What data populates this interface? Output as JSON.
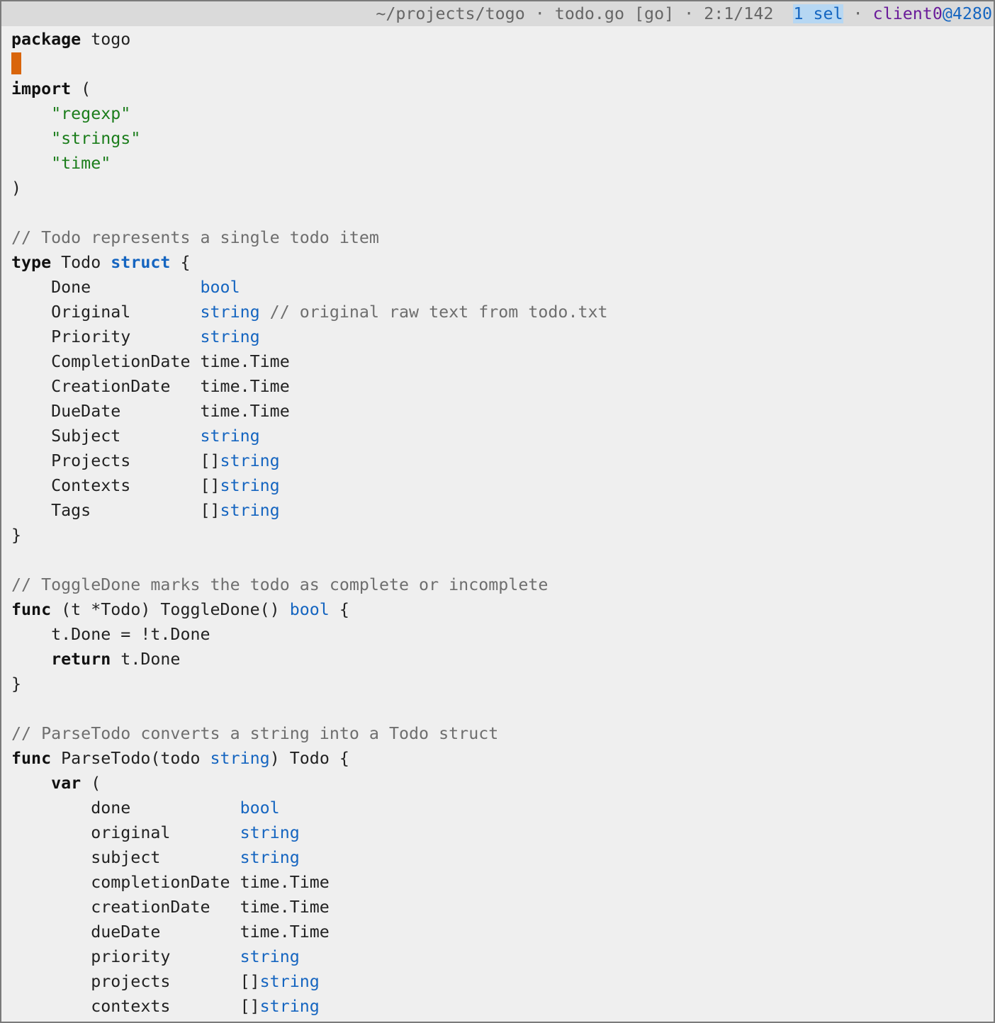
{
  "status": {
    "path": "~/projects/togo",
    "sep": " · ",
    "file": "todo.go",
    "filetype": "[go]",
    "position": "2:1/142",
    "selections": "1 sel",
    "client": "client0",
    "session": "@4280"
  },
  "lines": [
    [
      {
        "t": "package",
        "c": "kw"
      },
      {
        "t": " togo",
        "c": "p"
      }
    ],
    [
      {
        "t": "",
        "c": "cursor"
      }
    ],
    [
      {
        "t": "import",
        "c": "kw"
      },
      {
        "t": " (",
        "c": "p"
      }
    ],
    [
      {
        "t": "    ",
        "c": "p"
      },
      {
        "t": "\"regexp\"",
        "c": "str"
      }
    ],
    [
      {
        "t": "    ",
        "c": "p"
      },
      {
        "t": "\"strings\"",
        "c": "str"
      }
    ],
    [
      {
        "t": "    ",
        "c": "p"
      },
      {
        "t": "\"time\"",
        "c": "str"
      }
    ],
    [
      {
        "t": ")",
        "c": "p"
      }
    ],
    [],
    [
      {
        "t": "// Todo represents a single todo item",
        "c": "comment"
      }
    ],
    [
      {
        "t": "type",
        "c": "kw"
      },
      {
        "t": " Todo ",
        "c": "p"
      },
      {
        "t": "struct",
        "c": "kw-blue"
      },
      {
        "t": " {",
        "c": "p"
      }
    ],
    [
      {
        "t": "    Done           ",
        "c": "p"
      },
      {
        "t": "bool",
        "c": "type"
      }
    ],
    [
      {
        "t": "    Original       ",
        "c": "p"
      },
      {
        "t": "string",
        "c": "type"
      },
      {
        "t": " // original raw text from todo.txt",
        "c": "comment"
      }
    ],
    [
      {
        "t": "    Priority       ",
        "c": "p"
      },
      {
        "t": "string",
        "c": "type"
      }
    ],
    [
      {
        "t": "    CompletionDate time.Time",
        "c": "p"
      }
    ],
    [
      {
        "t": "    CreationDate   time.Time",
        "c": "p"
      }
    ],
    [
      {
        "t": "    DueDate        time.Time",
        "c": "p"
      }
    ],
    [
      {
        "t": "    Subject        ",
        "c": "p"
      },
      {
        "t": "string",
        "c": "type"
      }
    ],
    [
      {
        "t": "    Projects       []",
        "c": "p"
      },
      {
        "t": "string",
        "c": "type"
      }
    ],
    [
      {
        "t": "    Contexts       []",
        "c": "p"
      },
      {
        "t": "string",
        "c": "type"
      }
    ],
    [
      {
        "t": "    Tags           []",
        "c": "p"
      },
      {
        "t": "string",
        "c": "type"
      }
    ],
    [
      {
        "t": "}",
        "c": "p"
      }
    ],
    [],
    [
      {
        "t": "// ToggleDone marks the todo as complete or incomplete",
        "c": "comment"
      }
    ],
    [
      {
        "t": "func",
        "c": "kw"
      },
      {
        "t": " (t *Todo) ToggleDone() ",
        "c": "p"
      },
      {
        "t": "bool",
        "c": "type"
      },
      {
        "t": " {",
        "c": "p"
      }
    ],
    [
      {
        "t": "    t.Done = !t.Done",
        "c": "p"
      }
    ],
    [
      {
        "t": "    ",
        "c": "p"
      },
      {
        "t": "return",
        "c": "kw"
      },
      {
        "t": " t.Done",
        "c": "p"
      }
    ],
    [
      {
        "t": "}",
        "c": "p"
      }
    ],
    [],
    [
      {
        "t": "// ParseTodo converts a string into a Todo struct",
        "c": "comment"
      }
    ],
    [
      {
        "t": "func",
        "c": "kw"
      },
      {
        "t": " ParseTodo(todo ",
        "c": "p"
      },
      {
        "t": "string",
        "c": "type"
      },
      {
        "t": ") Todo {",
        "c": "p"
      }
    ],
    [
      {
        "t": "    ",
        "c": "p"
      },
      {
        "t": "var",
        "c": "kw"
      },
      {
        "t": " (",
        "c": "p"
      }
    ],
    [
      {
        "t": "        done           ",
        "c": "p"
      },
      {
        "t": "bool",
        "c": "type"
      }
    ],
    [
      {
        "t": "        original       ",
        "c": "p"
      },
      {
        "t": "string",
        "c": "type"
      }
    ],
    [
      {
        "t": "        subject        ",
        "c": "p"
      },
      {
        "t": "string",
        "c": "type"
      }
    ],
    [
      {
        "t": "        completionDate time.Time",
        "c": "p"
      }
    ],
    [
      {
        "t": "        creationDate   time.Time",
        "c": "p"
      }
    ],
    [
      {
        "t": "        dueDate        time.Time",
        "c": "p"
      }
    ],
    [
      {
        "t": "        priority       ",
        "c": "p"
      },
      {
        "t": "string",
        "c": "type"
      }
    ],
    [
      {
        "t": "        projects       []",
        "c": "p"
      },
      {
        "t": "string",
        "c": "type"
      }
    ],
    [
      {
        "t": "        contexts       []",
        "c": "p"
      },
      {
        "t": "string",
        "c": "type"
      }
    ]
  ]
}
